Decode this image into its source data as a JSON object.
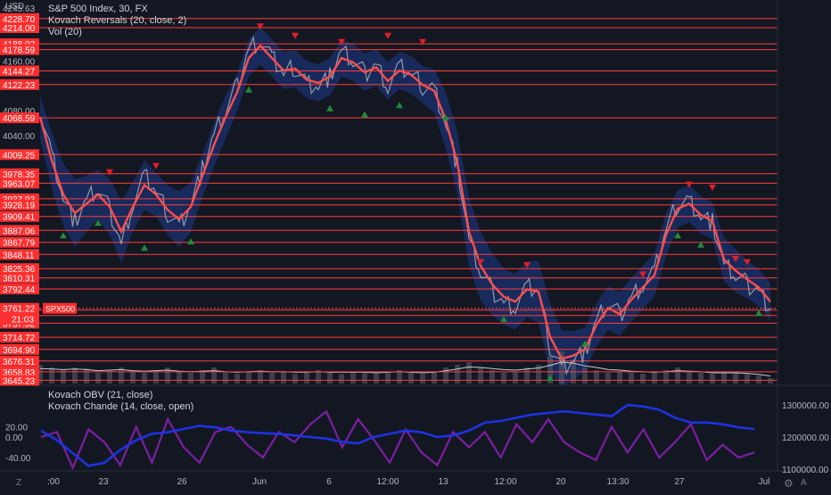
{
  "colors": {
    "background": "#131722",
    "level_line": "#ff3b3b",
    "label_bg": "#ff2f2f",
    "price_red": "#ff4d4d",
    "band_fill": "#1e3a8a",
    "candle": "#b2b5be",
    "buy_marker": "#1e8c3a",
    "sell_marker": "#e01e2b",
    "obv_line": "#1d33e0",
    "chande_line": "#7b1fa2",
    "volume_bar": "#5d606b",
    "text": "#d1d4dc",
    "axis_text": "#b2b5be"
  },
  "header": {
    "currency": "USD",
    "symbol_line": "S&P 500 Index, 30, FX",
    "indicator_1": "Kovach Reversals (20, close, 2)",
    "indicator_2": "Vol (20)",
    "lower_indicator_1": "Kovach OBV (21, close)",
    "lower_indicator_2": "Kovach Chande (14, close, open)"
  },
  "price_axis": {
    "top_partial": "4245.63",
    "plain_ticks": [
      "4160.00",
      "4080.00",
      "4040.00"
    ],
    "level_labels": [
      "4228.70",
      "4214.00",
      "4188.02",
      "4178.59",
      "4144.27",
      "4122.23",
      "4068.59",
      "4009.25",
      "3978.35",
      "3963.07",
      "3937.93",
      "3928.19",
      "3909.41",
      "3887.06",
      "3867.79",
      "3848.11",
      "3825.36",
      "3810.31",
      "3792.44",
      "3758.34",
      "3749.72",
      "3737.32",
      "3714.72",
      "3694.90",
      "3676.31",
      "3658.83",
      "3645.23"
    ],
    "current_price": "3761.22",
    "countdown": "21:03",
    "symbol_tag": "SPX500"
  },
  "lower_axis_left": [
    "20.00",
    "0.00",
    "-40.00"
  ],
  "lower_axis_right": [
    "1300000.00",
    "1200000.00",
    "1100000.00"
  ],
  "time_axis": {
    "labels": [
      ":00",
      "23",
      "26",
      "Jun",
      "6",
      "12:00",
      "13",
      "12:00",
      "20",
      "13:30",
      "27",
      "Jul"
    ],
    "zoom_icon": "Z",
    "auto_icon": "A",
    "settings_icon": "gear-icon"
  },
  "chart_data": {
    "type": "line",
    "title": "S&P 500 Index, 30, FX",
    "ylabel": "USD",
    "ylim": [
      3640,
      4250
    ],
    "price_series": {
      "name": "S&P 500 Index",
      "points": [
        4080,
        4010,
        3940,
        3900,
        3935,
        3955,
        3920,
        3865,
        3930,
        3975,
        3950,
        3915,
        3895,
        3930,
        3985,
        4040,
        4080,
        4120,
        4180,
        4195,
        4165,
        4140,
        4150,
        4125,
        4120,
        4135,
        4175,
        4160,
        4140,
        4155,
        4120,
        4150,
        4140,
        4120,
        4115,
        4060,
        3990,
        3870,
        3820,
        3790,
        3770,
        3765,
        3795,
        3790,
        3700,
        3665,
        3680,
        3690,
        3740,
        3770,
        3750,
        3780,
        3800,
        3820,
        3890,
        3930,
        3935,
        3910,
        3900,
        3830,
        3815,
        3800,
        3790,
        3761
      ]
    },
    "ma_series": {
      "name": "Kovach Reversals",
      "points": [
        4070,
        4000,
        3945,
        3915,
        3930,
        3945,
        3925,
        3885,
        3925,
        3960,
        3945,
        3920,
        3905,
        3925,
        3975,
        4025,
        4070,
        4110,
        4165,
        4185,
        4165,
        4145,
        4148,
        4130,
        4125,
        4135,
        4165,
        4158,
        4142,
        4150,
        4128,
        4145,
        4138,
        4122,
        4112,
        4065,
        3995,
        3885,
        3830,
        3800,
        3780,
        3772,
        3792,
        3788,
        3715,
        3680,
        3685,
        3695,
        3735,
        3762,
        3752,
        3775,
        3795,
        3815,
        3880,
        3922,
        3930,
        3912,
        3902,
        3840,
        3822,
        3808,
        3795,
        3772
      ]
    },
    "band_width": [
      35,
      45,
      50,
      55,
      45,
      40,
      45,
      50,
      40,
      40,
      35,
      40,
      45,
      40,
      35,
      35,
      35,
      30,
      30,
      30,
      30,
      30,
      30,
      30,
      30,
      30,
      30,
      30,
      30,
      30,
      30,
      30,
      30,
      30,
      35,
      45,
      50,
      55,
      55,
      50,
      45,
      45,
      45,
      50,
      55,
      45,
      40,
      35,
      35,
      35,
      35,
      35,
      35,
      35,
      35,
      30,
      30,
      30,
      30,
      35,
      35,
      30,
      30,
      30
    ],
    "volume": [
      0.35,
      0.3,
      0.25,
      0.3,
      0.28,
      0.2,
      0.25,
      0.3,
      0.22,
      0.2,
      0.25,
      0.3,
      0.22,
      0.2,
      0.25,
      0.3,
      0.2,
      0.18,
      0.22,
      0.25,
      0.2,
      0.22,
      0.18,
      0.2,
      0.25,
      0.2,
      0.18,
      0.22,
      0.2,
      0.18,
      0.2,
      0.25,
      0.2,
      0.18,
      0.22,
      0.3,
      0.35,
      0.4,
      0.3,
      0.25,
      0.2,
      0.22,
      0.3,
      0.35,
      0.5,
      0.6,
      0.45,
      0.3,
      0.25,
      0.2,
      0.22,
      0.2,
      0.18,
      0.2,
      0.25,
      0.3,
      0.22,
      0.2,
      0.18,
      0.2,
      0.22,
      0.18,
      0.15,
      0.1
    ],
    "volume_ma": [
      0.28,
      0.27,
      0.26,
      0.27,
      0.26,
      0.24,
      0.25,
      0.26,
      0.24,
      0.23,
      0.24,
      0.25,
      0.23,
      0.22,
      0.23,
      0.24,
      0.22,
      0.21,
      0.22,
      0.23,
      0.22,
      0.22,
      0.21,
      0.21,
      0.22,
      0.21,
      0.21,
      0.21,
      0.21,
      0.2,
      0.21,
      0.22,
      0.21,
      0.2,
      0.21,
      0.24,
      0.27,
      0.31,
      0.3,
      0.28,
      0.26,
      0.25,
      0.27,
      0.29,
      0.34,
      0.4,
      0.38,
      0.33,
      0.3,
      0.26,
      0.25,
      0.23,
      0.22,
      0.21,
      0.22,
      0.24,
      0.23,
      0.22,
      0.2,
      0.2,
      0.2,
      0.19,
      0.17,
      0.14
    ],
    "buy_signals": [
      [
        2,
        3880
      ],
      [
        5,
        3900
      ],
      [
        9,
        3860
      ],
      [
        13,
        3870
      ],
      [
        18,
        4115
      ],
      [
        25,
        4085
      ],
      [
        28,
        4075
      ],
      [
        31,
        4090
      ],
      [
        35,
        4070
      ],
      [
        40,
        3745
      ],
      [
        44,
        3650
      ],
      [
        47,
        3705
      ],
      [
        55,
        3880
      ],
      [
        57,
        3865
      ],
      [
        62,
        3755
      ]
    ],
    "sell_signals": [
      [
        6,
        3980
      ],
      [
        10,
        3990
      ],
      [
        19,
        4215
      ],
      [
        22,
        4200
      ],
      [
        26,
        4190
      ],
      [
        30,
        4200
      ],
      [
        33,
        4190
      ],
      [
        38,
        3835
      ],
      [
        42,
        3830
      ],
      [
        52,
        3815
      ],
      [
        56,
        3960
      ],
      [
        58,
        3955
      ],
      [
        60,
        3840
      ],
      [
        61,
        3835
      ]
    ],
    "obv": [
      1220000,
      1190000,
      1150000,
      1110000,
      1120000,
      1160000,
      1190000,
      1210000,
      1215000,
      1225000,
      1235000,
      1230000,
      1220000,
      1215000,
      1212000,
      1210000,
      1205000,
      1200000,
      1195000,
      1185000,
      1180000,
      1200000,
      1210000,
      1220000,
      1215000,
      1200000,
      1205000,
      1220000,
      1245000,
      1250000,
      1260000,
      1270000,
      1275000,
      1280000,
      1275000,
      1270000,
      1265000,
      1300000,
      1295000,
      1285000,
      1260000,
      1245000,
      1245000,
      1240000,
      1230000,
      1225000
    ],
    "chande": [
      0,
      10,
      -60,
      15,
      -10,
      -55,
      20,
      -50,
      35,
      -20,
      -50,
      10,
      20,
      -15,
      -40,
      10,
      -10,
      25,
      50,
      -20,
      35,
      -5,
      -50,
      15,
      -30,
      -55,
      10,
      -20,
      10,
      -40,
      25,
      -10,
      35,
      -10,
      -30,
      -45,
      20,
      -30,
      15,
      -40,
      -10,
      25,
      -45,
      -15,
      -40,
      -30
    ]
  }
}
